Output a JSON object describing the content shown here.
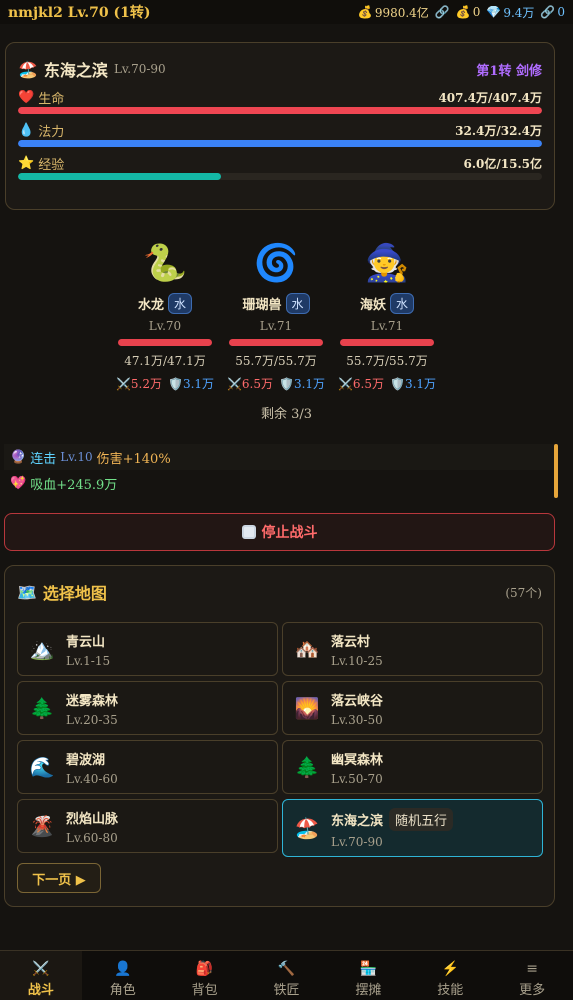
{
  "topbar": {
    "player": "nmjkl2 Lv.70 (1转)",
    "gold": "9980.4亿",
    "chain1": "",
    "bag": "0",
    "gem": "9.4万",
    "chain2": "0"
  },
  "zone": {
    "name": "东海之滨",
    "level_range": "Lv.70-90",
    "class_label": "第1转 剑修",
    "bars": [
      {
        "label": "生命",
        "value": "407.4万/407.4万",
        "fraction": 1.0,
        "color": "#ef4652"
      },
      {
        "label": "法力",
        "value": "32.4万/32.4万",
        "fraction": 1.0,
        "color": "#3b82f6"
      },
      {
        "label": "经验",
        "value": "6.0亿/15.5亿",
        "fraction": 0.387,
        "color": "#14b8a6"
      }
    ]
  },
  "enemies": [
    {
      "name": "水龙",
      "element": "水",
      "level": "Lv.70",
      "hp": "47.1万/47.1万",
      "atk": "5.2万",
      "def": "3.1万",
      "icon": "snake-icon"
    },
    {
      "name": "珊瑚兽",
      "element": "水",
      "level": "Lv.71",
      "hp": "55.7万/55.7万",
      "atk": "6.5万",
      "def": "3.1万",
      "icon": "swirl-icon"
    },
    {
      "name": "海妖",
      "element": "水",
      "level": "Lv.71",
      "hp": "55.7万/55.7万",
      "atk": "6.5万",
      "def": "3.1万",
      "icon": "witch-icon"
    }
  ],
  "remaining": "剩余 3/3",
  "log": {
    "combo_name": "连击",
    "combo_lv": "Lv.10",
    "combo_effect": "伤害+140%",
    "lifesteal": "吸血+245.9万"
  },
  "stop_button": "停止战斗",
  "maps": {
    "title": "选择地图",
    "count": "(57个)",
    "items": [
      {
        "name": "青云山",
        "levels": "Lv.1-15",
        "icon": "mountain-icon"
      },
      {
        "name": "落云村",
        "levels": "Lv.10-25",
        "icon": "village-icon"
      },
      {
        "name": "迷雾森林",
        "levels": "Lv.20-35",
        "icon": "tree-icon"
      },
      {
        "name": "落云峡谷",
        "levels": "Lv.30-50",
        "icon": "sunset-icon"
      },
      {
        "name": "碧波湖",
        "levels": "Lv.40-60",
        "icon": "wave-icon"
      },
      {
        "name": "幽冥森林",
        "levels": "Lv.50-70",
        "icon": "tree-icon"
      },
      {
        "name": "烈焰山脉",
        "levels": "Lv.60-80",
        "icon": "volcano-icon"
      },
      {
        "name": "东海之滨",
        "levels": "Lv.70-90",
        "icon": "beach-icon",
        "tag": "随机五行"
      }
    ],
    "next_page": "下一页 ▶"
  },
  "nav": [
    {
      "label": "战斗",
      "icon": "swords-icon",
      "active": true
    },
    {
      "label": "角色",
      "icon": "person-icon"
    },
    {
      "label": "背包",
      "icon": "backpack-icon"
    },
    {
      "label": "铁匠",
      "icon": "hammer-icon"
    },
    {
      "label": "摆摊",
      "icon": "shop-icon"
    },
    {
      "label": "技能",
      "icon": "lightning-icon"
    },
    {
      "label": "更多",
      "icon": "menu-icon"
    }
  ]
}
